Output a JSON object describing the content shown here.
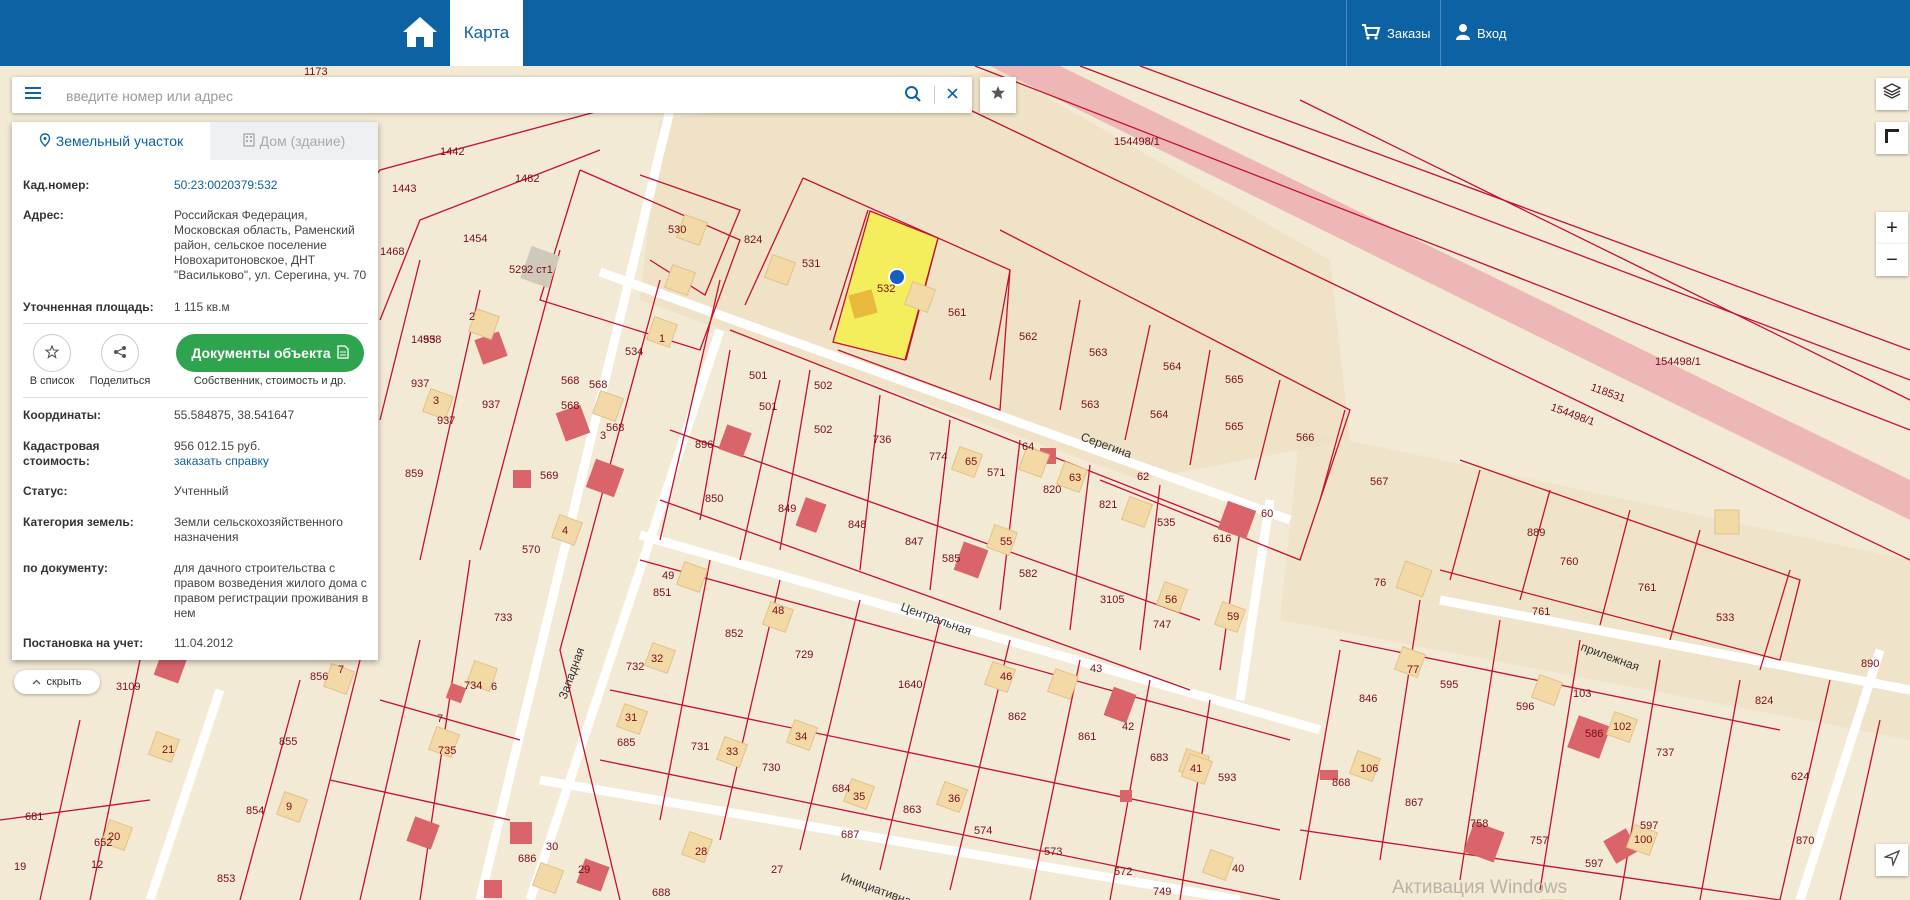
{
  "header": {
    "map_tab": "Карта",
    "orders": "Заказы",
    "login": "Вход"
  },
  "search": {
    "placeholder": "введите номер или адрес"
  },
  "panel": {
    "tab_land": "Земельный участок",
    "tab_house": "Дом (здание)",
    "cad_label": "Кад.номер:",
    "cad_value": "50:23:0020379:532",
    "addr_label": "Адрес:",
    "addr_value": "Российская Федерация, Московская область, Раменский район, сельское поселение Новохаритоновское, ДНТ \"Васильково\", ул. Серегина, уч. 70",
    "area_label": "Уточненная площадь:",
    "area_value": "1 115 кв.м",
    "add_list": "В список",
    "share": "Поделиться",
    "docs_button": "Документы объекта",
    "docs_caption": "Собственник, стоимость и др.",
    "coords_label": "Координаты:",
    "coords_value": "55.584875, 38.541647",
    "cost_label": "Кадастровая стоимость:",
    "cost_value": "956 012.15 руб.",
    "cost_link": "заказать справку",
    "status_label": "Статус:",
    "status_value": "Учтенный",
    "category_label": "Категория земель:",
    "category_value": "Земли сельскохозяйственного назначения",
    "doc_label": "по документу:",
    "doc_value": "для дачного строительства с правом возведения жилого дома с правом регистрации проживания в нем",
    "reg_label": "Постановка на учет:",
    "reg_value": "11.04.2012"
  },
  "hide_button": "скрыть",
  "map": {
    "zoom_in": "+",
    "zoom_out": "−",
    "streets": [
      "Серегина",
      "Центральная",
      "прилежная",
      "Западная",
      "Инициативная"
    ],
    "railway_labels": [
      "154498/1",
      "154498/1",
      "154498/1",
      "118531"
    ],
    "parcels": [
      "1173",
      "1442",
      "1443",
      "1482",
      "1454",
      "1468",
      "530",
      "824",
      "531",
      "532",
      "561",
      "562",
      "563",
      "564",
      "565",
      "563",
      "564",
      "565",
      "566",
      "567",
      "501",
      "502",
      "501",
      "502",
      "896",
      "736",
      "774",
      "571",
      "820",
      "821",
      "535",
      "616",
      "850",
      "849",
      "848",
      "847",
      "585",
      "582",
      "3105",
      "747",
      "1455",
      "938",
      "937",
      "937",
      "859",
      "569",
      "570",
      "733",
      "534",
      "568",
      "568",
      "568",
      "534",
      "851",
      "852",
      "729",
      "732",
      "685",
      "1640",
      "862",
      "861",
      "683",
      "593",
      "731",
      "730",
      "684",
      "863",
      "574",
      "573",
      "572",
      "749",
      "856",
      "3109",
      "855",
      "854",
      "853",
      "681",
      "652",
      "889",
      "760",
      "761",
      "533",
      "846",
      "595",
      "596",
      "586",
      "737",
      "868",
      "867",
      "757",
      "597",
      "624",
      "870",
      "890",
      "824",
      "76",
      "687",
      "686",
      "688",
      "2 ст1",
      "529",
      "1"
    ]
  },
  "watermark": "Активация Windows",
  "colors": {
    "header": "#0d62a4",
    "map_bg": "#f3ead5",
    "parcel_line": "#c8102e",
    "selected": "#f5ee5c",
    "railway": "#eeb7b7",
    "button_green": "#2ea44f"
  },
  "icons": [
    "home-icon",
    "cart-icon",
    "user-icon",
    "menu-icon",
    "search-icon",
    "clear-icon",
    "star-icon",
    "pin-icon",
    "building-icon",
    "share-icon",
    "document-icon",
    "layers-icon",
    "ruler-icon",
    "locate-icon",
    "chevron-up-icon"
  ]
}
